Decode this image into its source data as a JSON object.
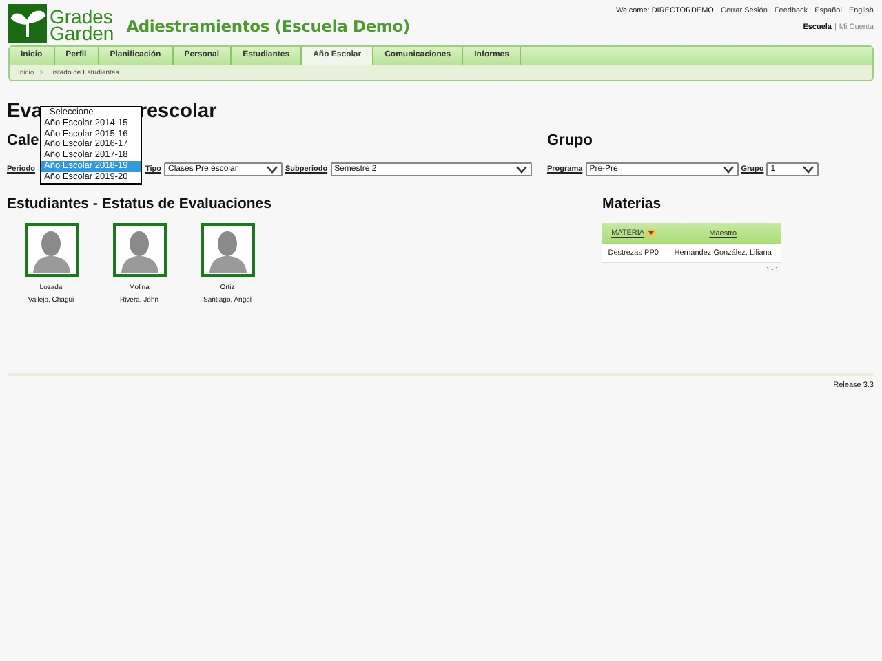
{
  "header": {
    "logo_top": "Grades",
    "logo_bottom": "Garden",
    "title": "Adiestramientos (Escuela Demo)",
    "welcome": "Welcome: DIRECTORDEMO",
    "links": [
      "Cerrar Sesión",
      "Feedback",
      "Español",
      "English"
    ],
    "account": [
      {
        "label": "Escuela",
        "selected": true
      },
      {
        "label": "Mi Cuenta",
        "selected": false
      }
    ],
    "separator": "|"
  },
  "tabs": [
    {
      "label": "Inicio",
      "selected": false
    },
    {
      "label": "Perfil",
      "selected": false
    },
    {
      "label": "Planificación",
      "selected": false
    },
    {
      "label": "Personal",
      "selected": false
    },
    {
      "label": "Estudiantes",
      "selected": false
    },
    {
      "label": "Año Escolar",
      "selected": true
    },
    {
      "label": "Comunicaciones",
      "selected": false
    },
    {
      "label": "Informes",
      "selected": false
    }
  ],
  "breadcrumb": {
    "items": [
      "Inicio",
      "Listado de Estudiantes"
    ],
    "separator": ">"
  },
  "page_title": {
    "visible_start": "Eva",
    "visible_end": "rescolar"
  },
  "calendar": {
    "heading_visible": "Cale",
    "filters": [
      {
        "label": "Periodo"
      },
      {
        "label": "Tipo",
        "value": "Clases Pre escolar"
      },
      {
        "label": "Subperiodo",
        "value": "Semestre 2"
      }
    ]
  },
  "periodo_dropdown": {
    "options": [
      {
        "label": "- Seleccione -",
        "selected": false
      },
      {
        "label": "Año Escolar 2014-15",
        "selected": false
      },
      {
        "label": "Año Escolar 2015-16",
        "selected": false
      },
      {
        "label": "Año Escolar 2016-17",
        "selected": false
      },
      {
        "label": "Año Escolar 2017-18",
        "selected": false
      },
      {
        "label": "Año Escolar 2018-19",
        "selected": true
      },
      {
        "label": "Año Escolar 2019-20",
        "selected": false
      }
    ]
  },
  "grupo": {
    "heading": "Grupo",
    "filters": [
      {
        "label": "Programa",
        "value": "Pre-Pre"
      },
      {
        "label": "Grupo",
        "value": "1"
      }
    ]
  },
  "students": {
    "heading": "Estudiantes - Estatus de Evaluaciones",
    "items": [
      {
        "line1": "Lozada",
        "line2": "Vallejo, Chagui"
      },
      {
        "line1": "Molina",
        "line2": "Rivera, John"
      },
      {
        "line1": "Ortiz",
        "line2": "Santiago, Angel"
      }
    ]
  },
  "materias": {
    "heading": "Materias",
    "columns": [
      "MATERIA",
      "Maestro"
    ],
    "rows": [
      [
        "Destrezas PP0",
        "Hernández González, Liliana"
      ]
    ],
    "pager": "1 - 1"
  },
  "footer": {
    "release": "Release 3.3"
  }
}
